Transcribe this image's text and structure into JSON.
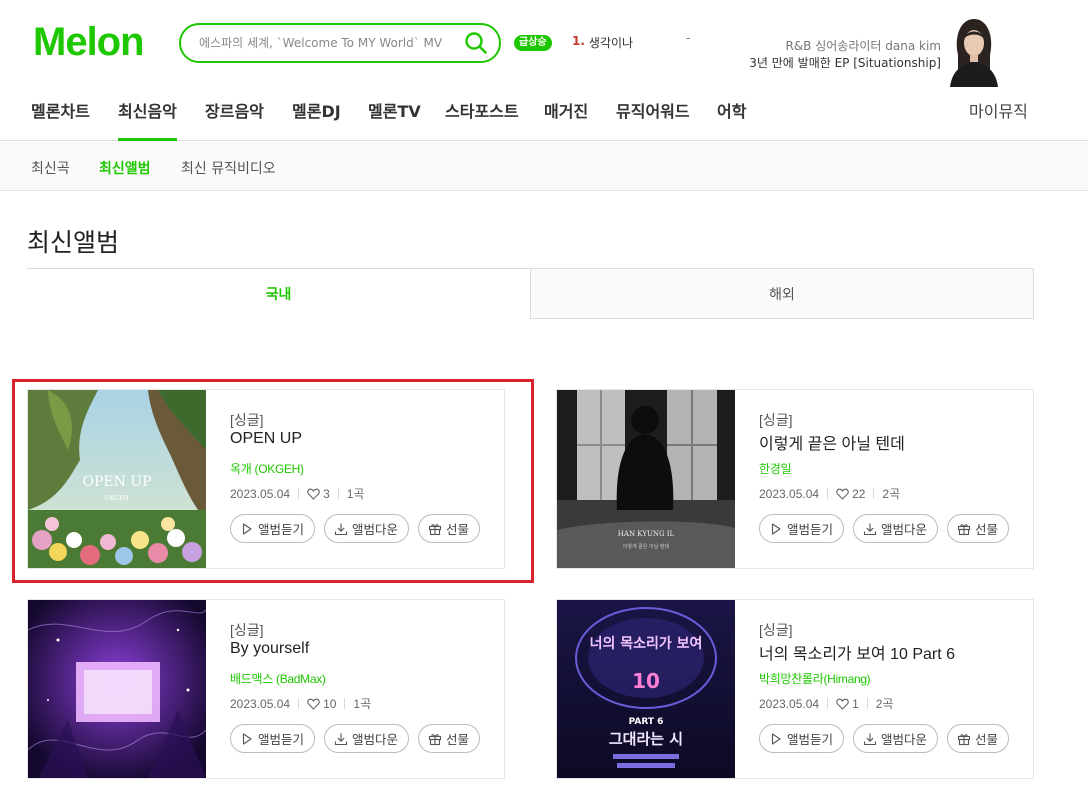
{
  "header": {
    "logo_text": "Melon",
    "search": {
      "placeholder": "에스파의 세계, `Welcome To MY World` MV"
    },
    "rising": {
      "badge": "급상승",
      "rank": "1.",
      "keyword": "생각이나",
      "extra": "-"
    },
    "promo": {
      "line1": "R&B 싱어송라이터 dana kim",
      "line2": "3년 만에 발매한 EP [Situationship]"
    }
  },
  "nav": {
    "items": [
      "멜론차트",
      "최신음악",
      "장르음악",
      "멜론DJ",
      "멜론TV",
      "스타포스트",
      "매거진",
      "뮤직어워드",
      "어학"
    ],
    "active": "최신음악",
    "my_music": "마이뮤직"
  },
  "subnav": {
    "items": [
      "최신곡",
      "최신앨범",
      "최신 뮤직비디오"
    ],
    "active": "최신앨범"
  },
  "page": {
    "title": "최신앨범",
    "tabs": {
      "domestic": "국내",
      "overseas": "해외"
    }
  },
  "button_labels": {
    "listen": "앨범듣기",
    "download": "앨범다운",
    "gift": "선물"
  },
  "albums": [
    {
      "type": "[싱글]",
      "title": "OPEN UP",
      "artist": "옥개 (OKGEH)",
      "date": "2023.05.04",
      "likes": "3",
      "tracks": "1곡",
      "cover_text": "OPEN UP",
      "cover_sub": "OKGEH"
    },
    {
      "type": "[싱글]",
      "title": "이렇게 끝은 아닐 텐데",
      "artist": "한경일",
      "date": "2023.05.04",
      "likes": "22",
      "tracks": "2곡",
      "cover_text": "HAN KYUNG IL",
      "cover_sub": "이렇게 끝은 아닐 텐데"
    },
    {
      "type": "[싱글]",
      "title": "By yourself",
      "artist": "배드맥스 (BadMax)",
      "date": "2023.05.04",
      "likes": "10",
      "tracks": "1곡"
    },
    {
      "type": "[싱글]",
      "title": "너의 목소리가 보여 10 Part 6",
      "artist": "박희망찬롤라(Himang)",
      "date": "2023.05.04",
      "likes": "1",
      "tracks": "2곡",
      "cover_text": "너의 목소리가 보여",
      "cover_num": "10",
      "cover_part": "PART 6",
      "cover_song": "그대라는 시"
    }
  ],
  "colors": {
    "accent": "#1ec800",
    "highlight": "#d8232a"
  }
}
